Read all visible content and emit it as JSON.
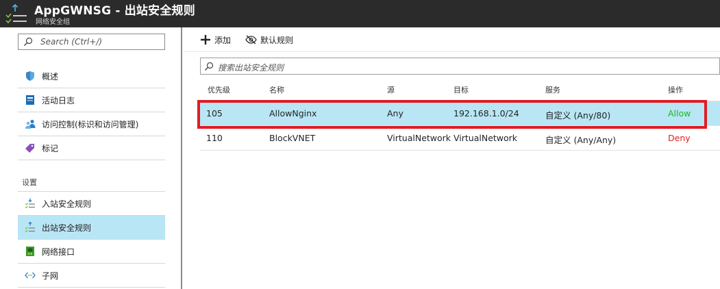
{
  "window": {
    "title": "AppGWNSG - 出站安全规则",
    "subtitle": "网络安全组",
    "icon": "outbound-rules-icon"
  },
  "sidebar": {
    "search_placeholder": "Search (Ctrl+/)",
    "items": [
      {
        "label": "概述",
        "icon": "shield-icon"
      },
      {
        "label": "活动日志",
        "icon": "activity-log-icon"
      },
      {
        "label": "访问控制(标识和访问管理)",
        "icon": "users-icon"
      },
      {
        "label": "标记",
        "icon": "tag-icon"
      }
    ],
    "section_settings": "设置",
    "settings_items": [
      {
        "label": "入站安全规则",
        "icon": "inbound-rules-icon",
        "selected": false
      },
      {
        "label": "出站安全规则",
        "icon": "outbound-rules-icon",
        "selected": true
      },
      {
        "label": "网络接口",
        "icon": "network-interface-icon",
        "selected": false
      },
      {
        "label": "子网",
        "icon": "subnet-icon",
        "selected": false
      }
    ]
  },
  "toolbar": {
    "add_label": "添加",
    "default_rules_label": "默认规则"
  },
  "filter": {
    "placeholder": "搜索出站安全规则"
  },
  "table": {
    "columns": [
      "优先级",
      "名称",
      "源",
      "目标",
      "服务",
      "操作"
    ],
    "rows": [
      {
        "priority": "105",
        "name": "AllowNginx",
        "source": "Any",
        "destination": "192.168.1.0/24",
        "service": "自定义 (Any/80)",
        "action": "Allow",
        "selected": true
      },
      {
        "priority": "110",
        "name": "BlockVNET",
        "source": "VirtualNetwork",
        "destination": "VirtualNetwork",
        "service": "自定义 (Any/Any)",
        "action": "Deny",
        "selected": false
      }
    ]
  },
  "colors": {
    "titlebar_bg": "#2b2b2b",
    "selected_bg": "#b9e6f5",
    "allow": "#1eb81e",
    "deny": "#e02020",
    "highlight_border": "#e01b24"
  }
}
